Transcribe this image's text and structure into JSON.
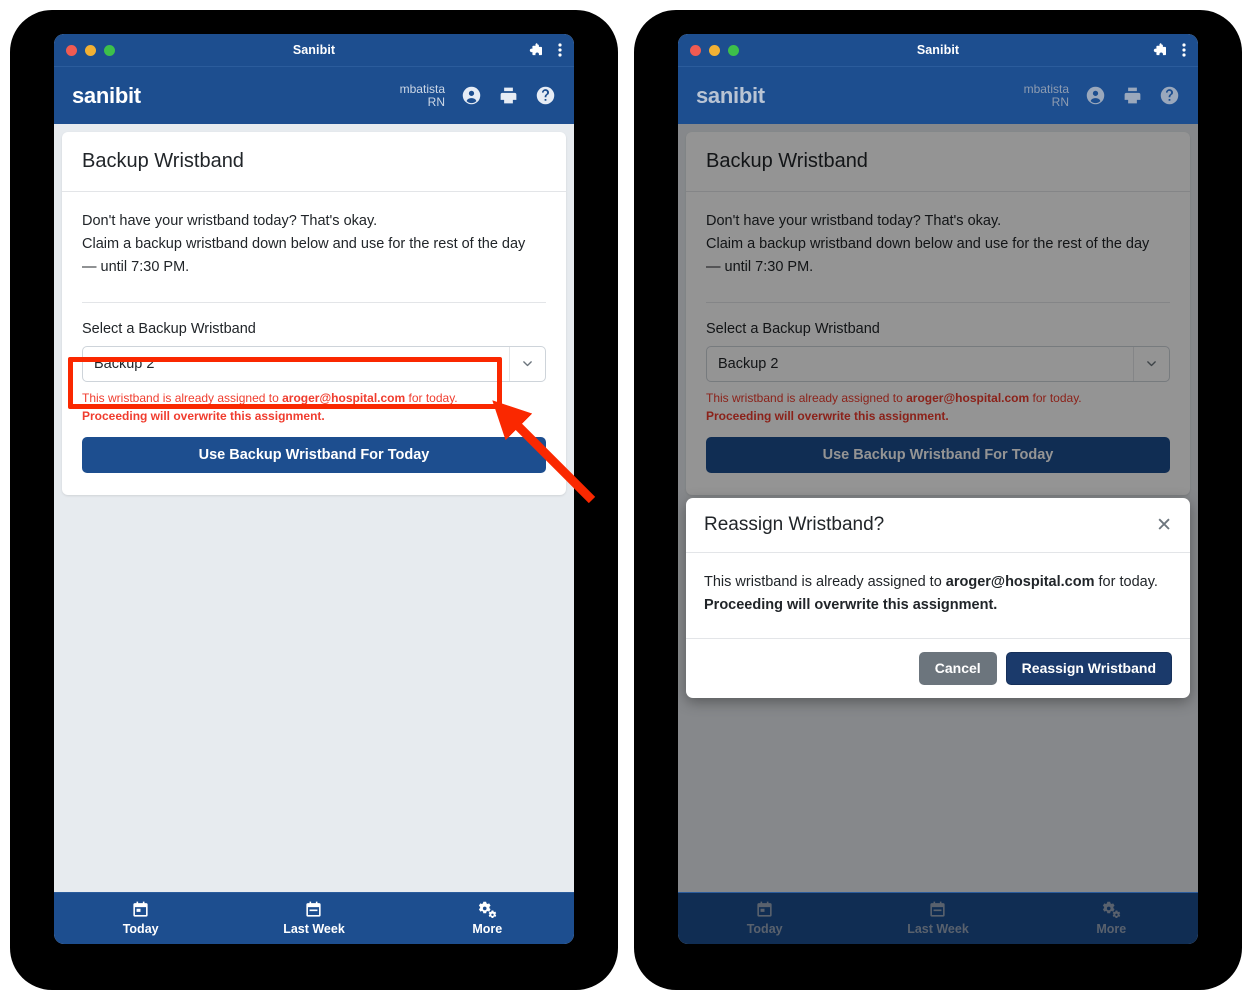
{
  "window": {
    "title": "Sanibit",
    "traffic_lights": [
      "close-red",
      "minimize-yellow",
      "maximize-green"
    ],
    "extensions_icon": "puzzle-piece-icon",
    "menu_icon": "three-dot-menu-icon"
  },
  "app_header": {
    "brand": "sanibit",
    "user_name": "mbatista",
    "user_role": "RN",
    "icons": [
      "account-circle-icon",
      "printer-icon",
      "help-circle-icon"
    ]
  },
  "card": {
    "title": "Backup Wristband",
    "intro_line1": "Don't have your wristband today? That's okay.",
    "intro_line2": "Claim a backup wristband down below and use for the rest of the day",
    "intro_line3": "— until 7:30 PM.",
    "select_label": "Select a Backup Wristband",
    "select_value": "Backup 2",
    "select_options": [
      "Backup 2"
    ],
    "warning_prefix": "This wristband is already assigned to ",
    "warning_email": "aroger@hospital.com",
    "warning_suffix": " for today.",
    "warning_bold": "Proceeding will overwrite this assignment.",
    "primary_button": "Use Backup Wristband For Today"
  },
  "modal": {
    "title": "Reassign Wristband?",
    "close_label": "✕",
    "body_prefix": "This wristband is already assigned to ",
    "body_email": "aroger@hospital.com",
    "body_suffix": " for today.",
    "body_bold": "Proceeding will overwrite this assignment.",
    "cancel_label": "Cancel",
    "confirm_label": "Reassign Wristband"
  },
  "bottom_nav": {
    "items": [
      {
        "label": "Today",
        "icon": "calendar-today-icon"
      },
      {
        "label": "Last Week",
        "icon": "calendar-week-icon"
      },
      {
        "label": "More",
        "icon": "gears-icon"
      }
    ]
  },
  "colors": {
    "brand_blue": "#1d4e8f",
    "navy": "#1b3a6b",
    "gray_button": "#6c757d",
    "warning_red": "#f03c2e",
    "annotation_red": "#fa2800",
    "page_bg": "#e7ebef"
  }
}
